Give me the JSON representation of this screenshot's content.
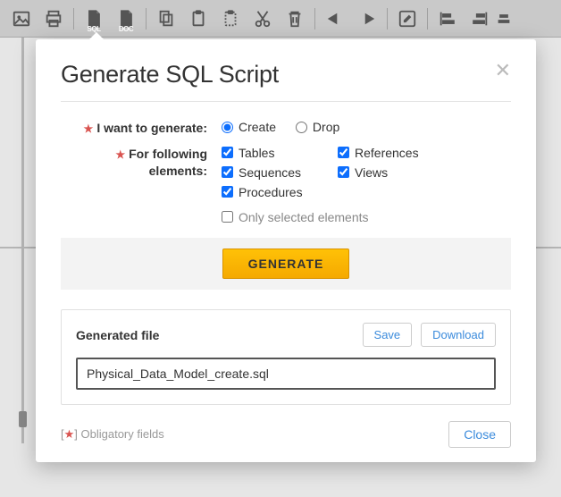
{
  "modal": {
    "title": "Generate SQL Script",
    "labels": {
      "want_to_generate": "I want to generate:",
      "for_elements": "For following elements:"
    },
    "radios": {
      "create": "Create",
      "drop": "Drop",
      "selected": "create"
    },
    "checkboxes": {
      "tables": {
        "label": "Tables",
        "checked": true
      },
      "references": {
        "label": "References",
        "checked": true
      },
      "sequences": {
        "label": "Sequences",
        "checked": true
      },
      "views": {
        "label": "Views",
        "checked": true
      },
      "procedures": {
        "label": "Procedures",
        "checked": true
      },
      "only_selected": {
        "label": "Only selected elements",
        "checked": false
      }
    },
    "generate_button": "GENERATE",
    "file_section": {
      "title": "Generated file",
      "save": "Save",
      "download": "Download",
      "filename": "Physical_Data_Model_create.sql"
    },
    "obligatory_note": "] Obligatory fields",
    "obligatory_star": "★",
    "close": "Close"
  }
}
